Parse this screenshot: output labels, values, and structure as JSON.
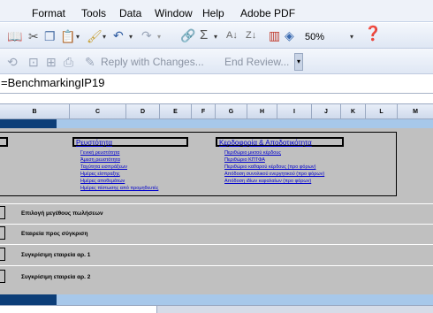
{
  "menu": [
    "Format",
    "Tools",
    "Data",
    "Window",
    "Help",
    "Adobe PDF"
  ],
  "toolbar": {
    "zoom": "50%",
    "review_text": "Reply with Changes...",
    "end_review": "End Review..."
  },
  "formula": "=BenchmarkingIP19",
  "columns": [
    "B",
    "C",
    "D",
    "E",
    "F",
    "G",
    "H",
    "I",
    "J",
    "K",
    "L",
    "M"
  ],
  "liquidity": {
    "title": "Ρευστότητα",
    "links": [
      "Γενική ρευστότητα",
      "Άμεση ρευστότητα",
      "Ταχύτητα εισπράξεων",
      "Ημέρες είσπραξης",
      "Ημέρες αποθεμάτων",
      "Ημέρες πίστωσης από προμηθευτές"
    ]
  },
  "profitability": {
    "title": "Κερδοφορία & Αποδοτικότητα",
    "links": [
      "Περιθώριο μικτού κέρδους",
      "Περιθώριο ΚΠΤΦΑ",
      "Περιθώριο καθαρού κέρδους (προ φόρων)",
      "Απόδοση συνολικού ενεργητικού (προ φόρων)",
      "Απόδοση ιδίων κεφαλαίων (προ φόρων)"
    ]
  },
  "selectors": [
    "Επιλογή μεγέθους πωλήσεων",
    "Εταιρεία προς σύγκριση",
    "Συγκρίσιμη εταιρεία αρ. 1",
    "Συγκρίσιμη εταιρεία αρ. 2"
  ],
  "colors": {
    "dark_band": "#0c3e78",
    "light_band": "#a7c8ea",
    "sheet_bg": "#c0c0c0",
    "link": "#0000cc"
  }
}
